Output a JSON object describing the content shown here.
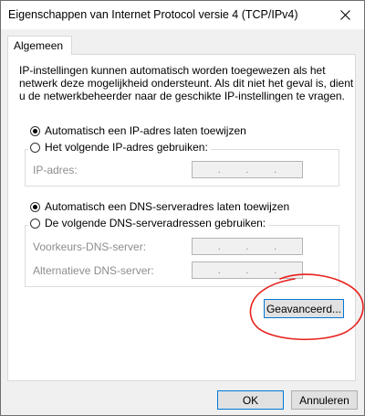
{
  "window": {
    "title": "Eigenschappen van Internet Protocol versie 4 (TCP/IPv4)"
  },
  "tabs": [
    {
      "label": "Algemeen"
    }
  ],
  "intro": {
    "lines": [
      "IP-instellingen kunnen automatisch worden toegewezen als het",
      "netwerk deze mogelijkheid ondersteunt. Als dit niet het geval is, dient",
      "u de netwerkbeheerder naar de geschikte IP-instellingen te vragen."
    ]
  },
  "ip": {
    "auto_label": "Automatisch een IP-adres laten toewijzen",
    "auto_selected": true,
    "manual_label": "Het volgende IP-adres gebruiken:",
    "manual_selected": false,
    "address_label": "IP-adres:",
    "address_value": ". . ."
  },
  "dns": {
    "auto_label": "Automatisch een DNS-serveradres laten toewijzen",
    "auto_selected": true,
    "manual_label": "De volgende DNS-serveradressen gebruiken:",
    "manual_selected": false,
    "preferred_label": "Voorkeurs-DNS-server:",
    "alternate_label": "Alternatieve DNS-server:"
  },
  "buttons": {
    "advanced": "Geavanceerd...",
    "ok": "OK",
    "cancel": "Annuleren"
  },
  "colors": {
    "focus_border": "#0078d7",
    "annotation": "#e8201c"
  },
  "icons": {
    "close": "close-icon"
  }
}
